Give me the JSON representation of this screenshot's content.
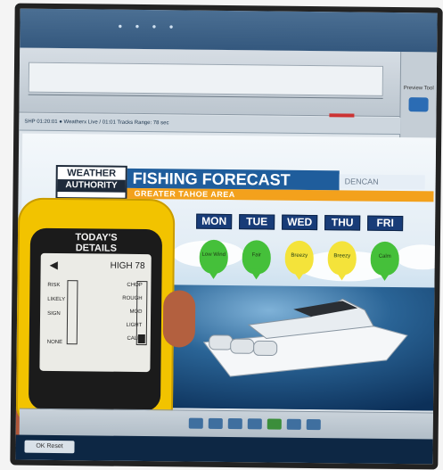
{
  "graphic": {
    "logo_line1": "WEATHER",
    "logo_line2": "AUTHORITY",
    "title": "FISHING FORECAST",
    "title_partner": "DENCAN",
    "subtitle": "GREATER TAHOE AREA"
  },
  "forecast": {
    "days": [
      {
        "label": "MON",
        "fish_text": "Low Wind",
        "color": "#45c03a"
      },
      {
        "label": "TUE",
        "fish_text": "Fair",
        "color": "#45c03a"
      },
      {
        "label": "WED",
        "fish_text": "Breezy",
        "color": "#f4e33a"
      },
      {
        "label": "THU",
        "fish_text": "Breezy",
        "color": "#f4e33a"
      },
      {
        "label": "FRI",
        "fish_text": "Calm",
        "color": "#45c03a"
      }
    ]
  },
  "device": {
    "screen_title_line1": "TODAY'S",
    "screen_title_line2": "DETAILS",
    "high_label": "HIGH",
    "high_value": "78",
    "left_column": [
      "RISK",
      "LIKELY",
      "SIGN",
      "NONE"
    ],
    "right_column": [
      "CHOP",
      "ROUGH",
      "MOD",
      "LIGHT",
      "CALM"
    ]
  },
  "editor": {
    "info_bar_text": "SHP 01:20:01 ● Weatherx Live / 01:01 Tracks Range: 78 sec",
    "side_panel_label": "Preview Tool",
    "bottom_button": "OK Reset"
  },
  "colors": {
    "title_blue": "#1f5d9c",
    "subtitle_orange": "#f3a11c",
    "day_label_blue": "#183c78",
    "device_yellow": "#f2c300"
  }
}
